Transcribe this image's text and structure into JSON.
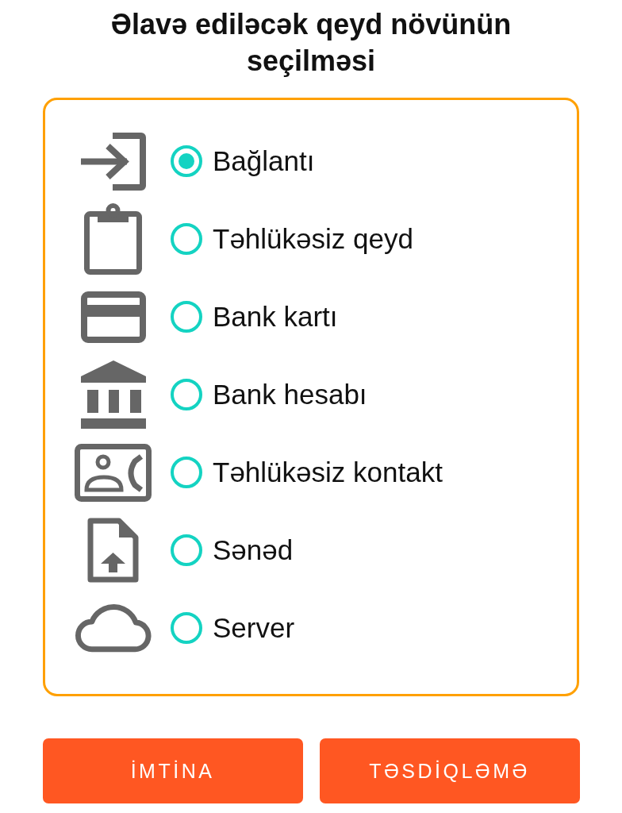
{
  "title": "Əlavə ediləcək qeyd növünün seçilməsi",
  "options": [
    {
      "kind": "login",
      "label": "Bağlantı",
      "selected": true
    },
    {
      "kind": "clipboard",
      "label": "Təhlükəsiz qeyd",
      "selected": false
    },
    {
      "kind": "card",
      "label": "Bank kartı",
      "selected": false
    },
    {
      "kind": "bank",
      "label": "Bank hesabı",
      "selected": false
    },
    {
      "kind": "contact",
      "label": "Təhlükəsiz kontakt",
      "selected": false
    },
    {
      "kind": "file",
      "label": "Sənəd",
      "selected": false
    },
    {
      "kind": "cloud",
      "label": "Server",
      "selected": false
    }
  ],
  "buttons": [
    "İMTİNA",
    "TƏSDİQLƏMƏ"
  ]
}
